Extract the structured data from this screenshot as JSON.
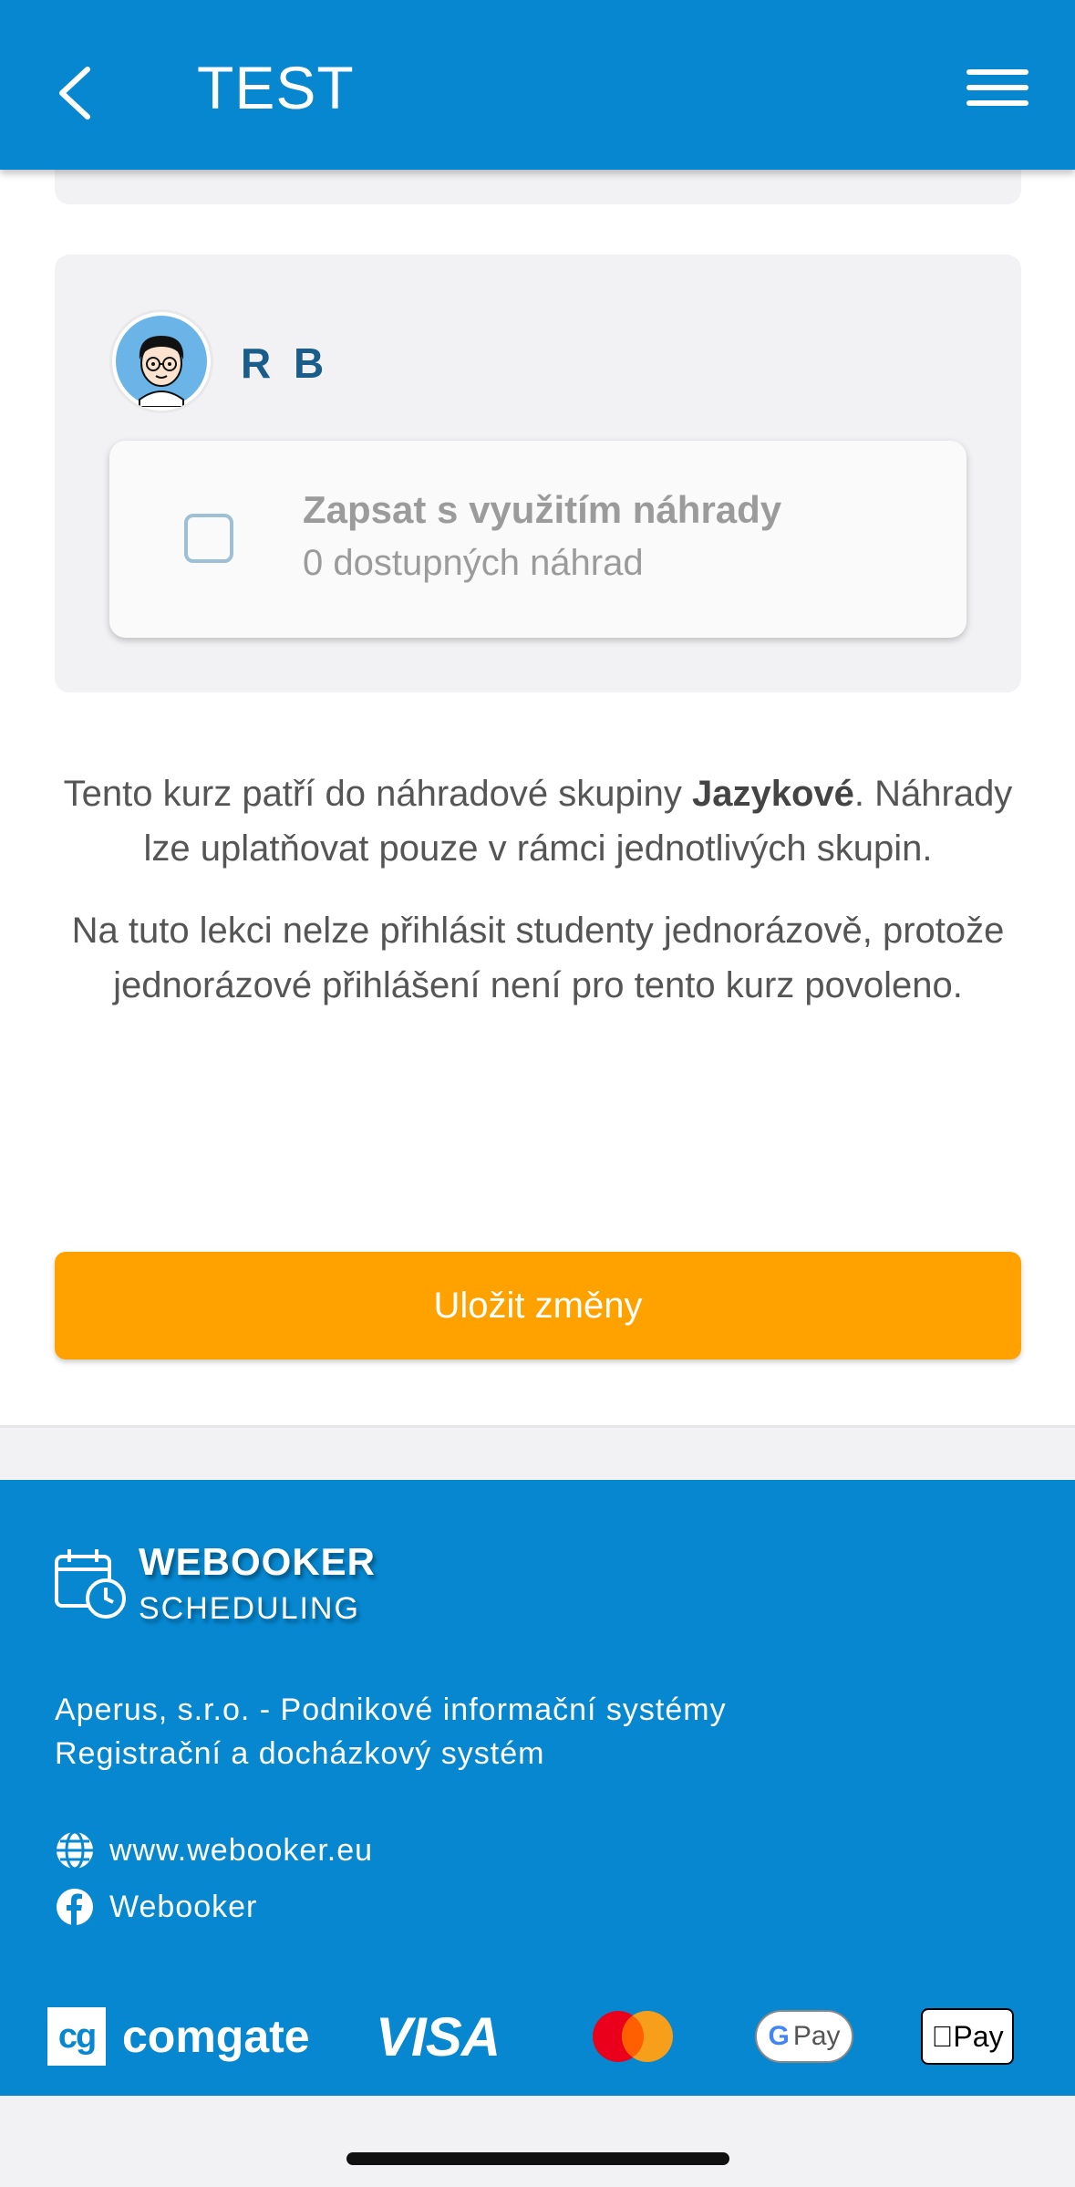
{
  "header": {
    "title": "TEST"
  },
  "student": {
    "name": "R B",
    "option_title": "Zapsat s využitím náhrady",
    "option_subtitle": "0 dostupných náhrad"
  },
  "info": {
    "line1_before": "Tento kurz patří do náhradové skupiny ",
    "line1_group": "Jazykové",
    "line1_after": ". Náhrady lze uplatňovat pouze v rámci jednotlivých skupin.",
    "line2": "Na tuto lekci nelze přihlásit studenty jednorázově, protože jednorázové přihlášení není pro tento kurz povoleno."
  },
  "actions": {
    "save_label": "Uložit změny"
  },
  "footer": {
    "brand_name": "WEBOOKER",
    "brand_sub": "SCHEDULING",
    "company_line1": "Aperus, s.r.o. - Podnikové informační systémy",
    "company_line2": "Registrační a docházkový systém",
    "website": "www.webooker.eu",
    "facebook": "Webooker",
    "payments": {
      "comgate_mark": "cg",
      "comgate": "comgate",
      "visa": "VISA",
      "gpay_g": "G",
      "gpay": "Pay",
      "applepay": "Pay"
    }
  },
  "colors": {
    "primary": "#0687d0",
    "accent": "#ffa200",
    "name": "#1a5c8a"
  }
}
